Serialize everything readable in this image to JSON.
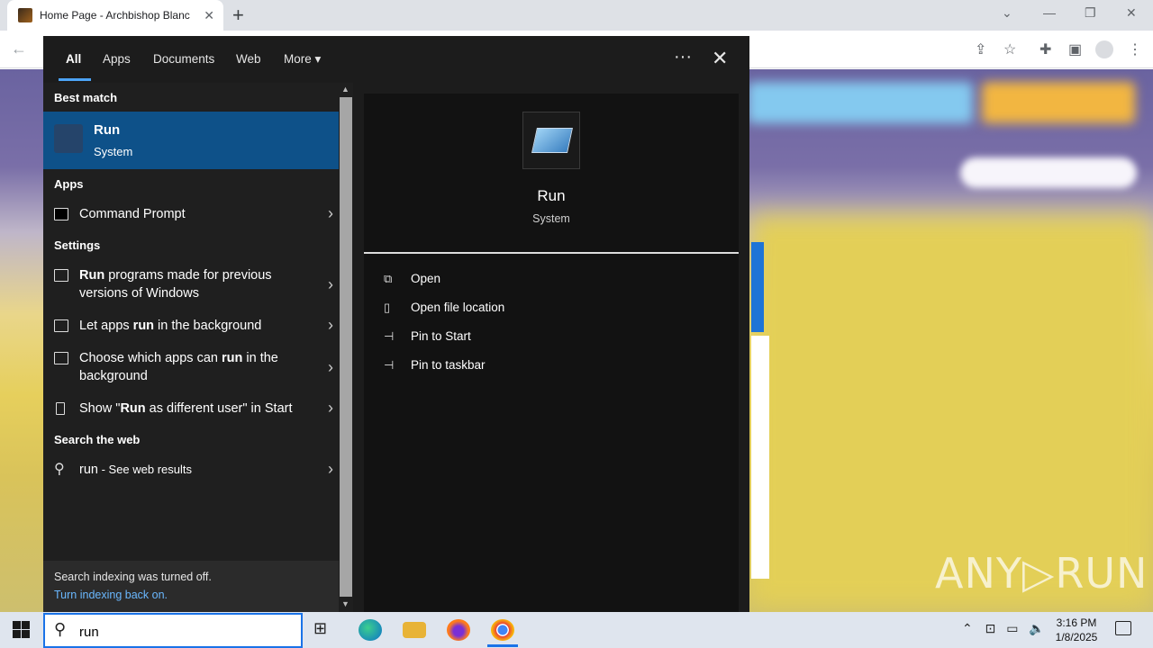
{
  "browser": {
    "tab_title": "Home Page - Archbishop Blanc",
    "new_tab": "+",
    "close_tab": "✕"
  },
  "menu": {
    "tabs": [
      "All",
      "Apps",
      "Documents",
      "Web",
      "More"
    ],
    "more_caret": "▾",
    "dots": "···",
    "close": "✕",
    "best_match_header": "Best match",
    "best_match": {
      "title": "Run",
      "subtitle": "System"
    },
    "apps_header": "Apps",
    "apps": [
      {
        "label": "Command Prompt"
      }
    ],
    "settings_header": "Settings",
    "settings": [
      {
        "html_bold": "Run",
        "label": " programs made for previous versions of Windows"
      },
      {
        "pre": "Let apps ",
        "bold": "run",
        "post": " in the background"
      },
      {
        "pre": "Choose which apps can ",
        "bold": "run",
        "post": " in the background"
      },
      {
        "pre": "Show \"",
        "bold": "Run",
        "post": " as different user\" in Start"
      }
    ],
    "web_header": "Search the web",
    "web": {
      "query": "run",
      "suffix": " - See web results"
    },
    "index_notice": "Search indexing was turned off.",
    "index_link": "Turn indexing back on."
  },
  "preview": {
    "title": "Run",
    "subtitle": "System",
    "actions": [
      "Open",
      "Open file location",
      "Pin to Start",
      "Pin to taskbar"
    ]
  },
  "taskbar": {
    "search_value": "run",
    "time": "3:16 PM",
    "date": "1/8/2025"
  },
  "watermark": "ANY▷RUN"
}
